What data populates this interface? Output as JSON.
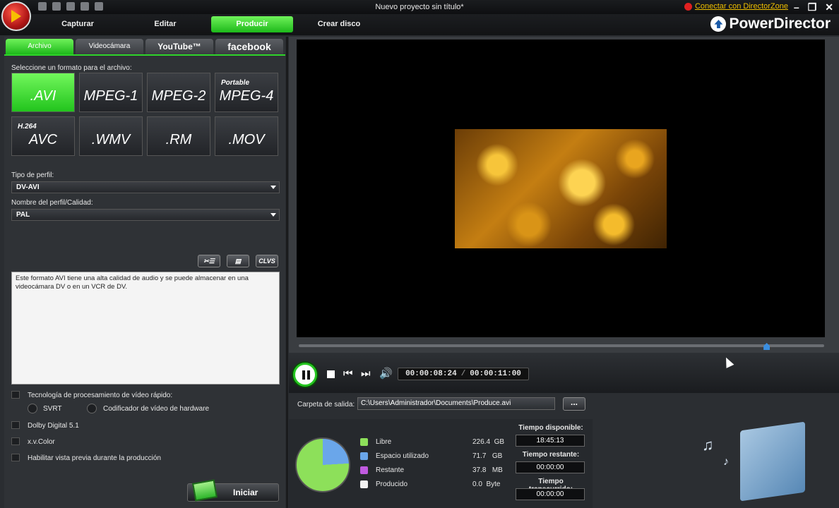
{
  "window": {
    "title": "Nuevo proyecto sin título*",
    "directorzone_link": "Conectar con DirectorZone",
    "brand": "PowerDirector",
    "controls": [
      "–",
      "❐",
      "✕"
    ]
  },
  "topnav": {
    "tabs": [
      {
        "label": "Capturar",
        "active": false
      },
      {
        "label": "Editar",
        "active": false
      },
      {
        "label": "Producir",
        "active": true
      },
      {
        "label": "Crear disco",
        "active": false
      }
    ]
  },
  "produce": {
    "subtabs": [
      {
        "label": "Archivo",
        "active": true
      },
      {
        "label": "Videocámara",
        "active": false
      },
      {
        "label": "YouTube™",
        "active": false
      },
      {
        "label": "facebook",
        "active": false
      }
    ],
    "format_prompt": "Seleccione un formato para el archivo:",
    "formats": [
      {
        "label": ".AVI",
        "sup": "",
        "active": true
      },
      {
        "label": "MPEG-1",
        "sup": "",
        "active": false
      },
      {
        "label": "MPEG-2",
        "sup": "",
        "active": false
      },
      {
        "label": "MPEG-4",
        "sup": "Portable",
        "active": false
      },
      {
        "label": "AVC",
        "sup": "H.264",
        "active": false
      },
      {
        "label": ".WMV",
        "sup": "",
        "active": false
      },
      {
        "label": ".RM",
        "sup": "",
        "active": false
      },
      {
        "label": ".MOV",
        "sup": "",
        "active": false
      }
    ],
    "profile_type_label": "Tipo de perfil:",
    "profile_type_value": "DV-AVI",
    "profile_name_label": "Nombre del perfil/Calidad:",
    "profile_name_value": "PAL",
    "tool_buttons": [
      "",
      "",
      "CLVS"
    ],
    "description": "Este formato AVI tiene una alta calidad de audio y se puede almacenar en una videocámara DV o en un VCR de DV.",
    "fast_tech_label": "Tecnología de procesamiento de vídeo rápido:",
    "svrt_label": "SVRT",
    "hw_encoder_label": "Codificador de vídeo de hardware",
    "dolby_label": "Dolby Digital 5.1",
    "xvcolor_label": "x.v.Color",
    "preview_label": "Habilitar vista previa durante la producción",
    "start_label": "Iniciar"
  },
  "player": {
    "current_time": "00:00:08:24",
    "separator": "/",
    "total_time": "00:00:11:00",
    "progress": 0.89
  },
  "output": {
    "folder_label": "Carpeta de salida:",
    "folder_path": "C:\\Users\\Administrador\\Documents\\Produce.avi",
    "browse_label": "..."
  },
  "disk": {
    "legend": [
      {
        "label": "Libre",
        "value": "226.4",
        "unit": "GB",
        "color": "#8de05a"
      },
      {
        "label": "Espacio utilizado",
        "value": "71.7",
        "unit": "GB",
        "color": "#6aa6ea"
      },
      {
        "label": "Restante",
        "value": "37.8",
        "unit": "MB",
        "color": "#c05ae0"
      },
      {
        "label": "Producido",
        "value": "0.0",
        "unit": "Byte",
        "color": "#f2f2f2"
      }
    ],
    "time_available_label": "Tiempo disponible:",
    "time_available": "18:45:13",
    "time_remaining_label": "Tiempo restante:",
    "time_remaining": "00:00:00",
    "time_elapsed_label": "Tiempo transcurrido:",
    "time_elapsed": "00:00:00"
  },
  "colors": {
    "accent_green": "#2fd42a",
    "pie_free": "#8de05a",
    "pie_used": "#6aa6ea"
  }
}
